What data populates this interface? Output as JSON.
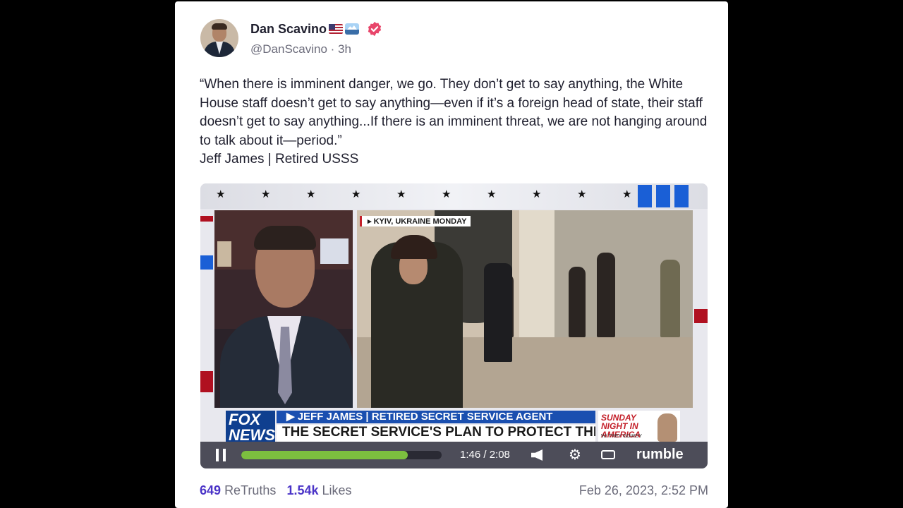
{
  "post": {
    "author_name": "Dan Scavino",
    "handle": "@DanScavino · 3h",
    "text_lines": [
      "“When there is imminent danger, we go. They don’t get to say anything, the White House staff doesn’t get to say anything—even if it’s a foreign head of state, their staff doesn’t get to say anything...If there is an imminent threat, we are not hanging around to talk about it—period.”",
      "Jeff James | Retired USSS"
    ],
    "badges": [
      "us-flag-icon",
      "wave-icon",
      "verified-icon"
    ],
    "accent_color": "#4a33c7",
    "verified_color": "#e8456a"
  },
  "video": {
    "location_tag": "▸ KYIV, UKRAINE MONDAY",
    "network_logo": "FOX NEWS",
    "lower_third_name": "▶ JEFF JAMES | RETIRED SECRET SERVICE AGENT",
    "lower_third_headline": "THE SECRET SERVICE'S PLAN TO PROTECT THE PRESIDENT",
    "promo_title": "SUNDAY NIGHT IN AMERICA",
    "promo_sub": "W/ TREY GOWDY",
    "player": {
      "time": "1:46 / 2:08",
      "progress": 0.83,
      "brand": "rumble",
      "state": "playing"
    }
  },
  "footer": {
    "retruths_count": "649",
    "retruths_label": "ReTruths",
    "likes_count": "1.54k",
    "likes_label": "Likes",
    "date": "Feb 26, 2023, 2:52 PM"
  }
}
